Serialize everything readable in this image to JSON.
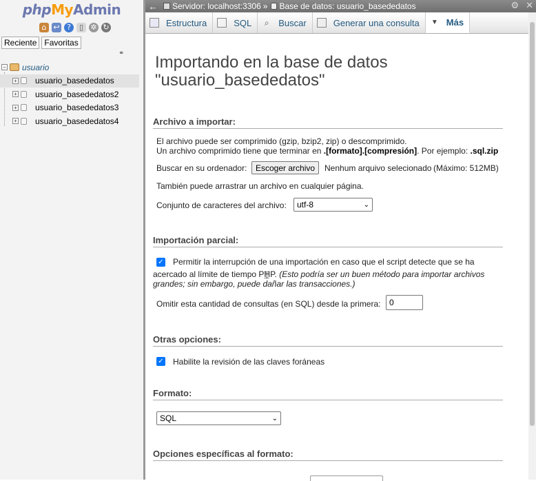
{
  "nav": {
    "logo": {
      "php": "php",
      "my": "My",
      "admin": "Admin"
    },
    "recent_tabs": [
      "Reciente",
      "Favoritas"
    ],
    "tree": {
      "root": "usuario",
      "items": [
        "usuario_basededatos",
        "usuario_basededatos2",
        "usuario_basededatos3",
        "usuario_basededatos4"
      ]
    }
  },
  "topbar": {
    "server": "Servidor: localhost:3306",
    "separator": "»",
    "database": "Base de datos: usuario_basededatos"
  },
  "tabs": [
    {
      "label": "Estructura",
      "icon": "structure-icon"
    },
    {
      "label": "SQL",
      "icon": "sql-icon"
    },
    {
      "label": "Buscar",
      "icon": "search-icon"
    },
    {
      "label": "Generar una consulta",
      "icon": "query-icon"
    },
    {
      "label": "Más",
      "icon": "triangle-down-icon"
    }
  ],
  "main": {
    "title_line1": "Importando en la base de datos",
    "title_line2": "\"usuario_basededatos\"",
    "file_section": {
      "legend": "Archivo a importar:",
      "compress_note": "El archivo puede ser comprimido (gzip, bzip2, zip) o descomprimido.",
      "compress_note2_a": "Un archivo comprimido tiene que terminar en ",
      "compress_note2_b": ".[formato].[compresión]",
      "compress_note2_c": ". Por ejemplo: ",
      "compress_note2_d": ".sql.zip",
      "browse_label": "Buscar en su ordenador:",
      "choose_button": "Escoger archivo",
      "no_file": "Nenhum arquivo selecionado",
      "max_size": "(Máximo: 512MB)",
      "drag_note": "También puede arrastrar un archivo en cualquier página.",
      "charset_label": "Conjunto de caracteres del archivo:",
      "charset_value": "utf-8"
    },
    "partial_section": {
      "legend": "Importación parcial:",
      "allow_interrupt_a": "Permitir la interrupción de una importación en caso que el script detecte que se ha",
      "allow_interrupt_b": "acercado al límite de tiempo PHP.",
      "allow_interrupt_c": "(Esto podría ser un buen método para importar archivos",
      "allow_interrupt_d": "grandes; sin embargo, puede dañar las transacciones.)",
      "skip_label": "Omitir esta cantidad de consultas (en SQL) desde la primera:",
      "skip_value": "0"
    },
    "other_section": {
      "legend": "Otras opciones:",
      "fk_label": "Habilite la revisión de las claves foráneas"
    },
    "format_section": {
      "legend": "Formato:",
      "format_value": "SQL"
    },
    "format_options_section": {
      "legend": "Opciones específicas al formato:"
    }
  },
  "colors": {
    "link": "#235a81",
    "checkbox": "#0075ff",
    "topbar": "#7a7a7a"
  }
}
